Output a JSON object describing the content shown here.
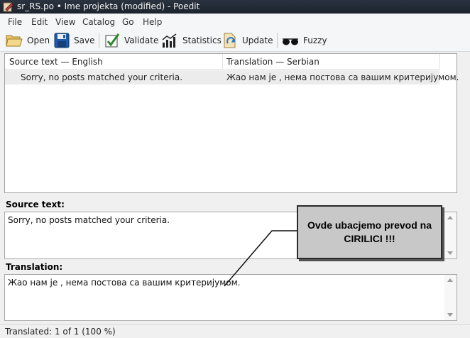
{
  "window": {
    "title": "sr_RS.po • Ime projekta (modified) - Poedit"
  },
  "menu": [
    "File",
    "Edit",
    "View",
    "Catalog",
    "Go",
    "Help"
  ],
  "toolbar": {
    "open": "Open",
    "save": "Save",
    "validate": "Validate",
    "statistics": "Statistics",
    "update": "Update",
    "fuzzy": "Fuzzy"
  },
  "list": {
    "col_source": "Source text — English",
    "col_translation": "Translation — Serbian",
    "rows": [
      {
        "source": "Sorry, no posts matched your criteria.",
        "translation": "Жао нам је , нема постова са вашим критеријумом."
      }
    ]
  },
  "source_panel": {
    "label": "Source text:",
    "text": "Sorry, no posts matched your criteria."
  },
  "translation_panel": {
    "label": "Translation:",
    "text": "Жао нам је , нема постова са вашим критеријумом."
  },
  "status": {
    "text": "Translated: 1 of 1 (100 %)"
  },
  "callout": {
    "text": "Ovde ubacjemo prevod na\nCIRILICI !!!"
  }
}
